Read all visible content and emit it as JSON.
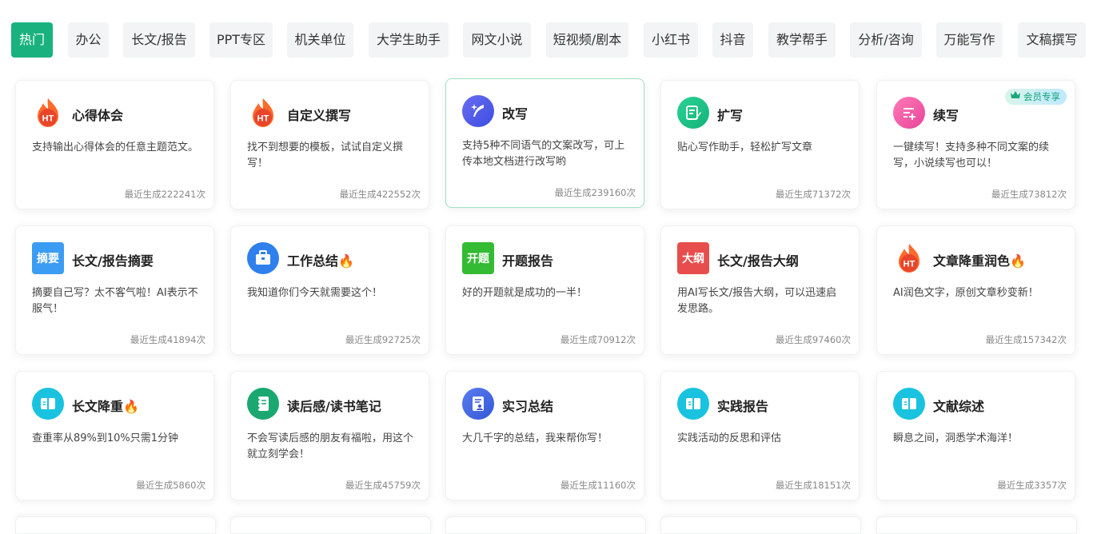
{
  "tabs": [
    {
      "label": "热门",
      "active": true
    },
    {
      "label": "办公"
    },
    {
      "label": "长文/报告"
    },
    {
      "label": "PPT专区"
    },
    {
      "label": "机关单位"
    },
    {
      "label": "大学生助手"
    },
    {
      "label": "网文小说"
    },
    {
      "label": "短视频/剧本"
    },
    {
      "label": "小红书"
    },
    {
      "label": "抖音"
    },
    {
      "label": "教学帮手"
    },
    {
      "label": "分析/咨询"
    },
    {
      "label": "万能写作"
    },
    {
      "label": "文稿撰写"
    }
  ],
  "cards": [
    {
      "title": "心得体会",
      "desc": "支持输出心得体会的任意主题范文。",
      "count": "最近生成222241次",
      "icon": "fire-ht-icon"
    },
    {
      "title": "自定义撰写",
      "desc": "找不到想要的模板，试试自定义撰写！",
      "count": "最近生成422552次",
      "icon": "fire-ht-icon"
    },
    {
      "title": "改写",
      "desc": "支持5种不同语气的文案改写，可上传本地文档进行改写哟",
      "count": "最近生成239160次",
      "icon": "feather-sparkle-icon"
    },
    {
      "title": "扩写",
      "desc": "贴心写作助手，轻松扩写文章",
      "count": "最近生成71372次",
      "icon": "edit-note-icon"
    },
    {
      "title": "续写",
      "desc": "一键续写！支持多种不同文案的续写，小说续写也可以！",
      "count": "最近生成73812次",
      "icon": "continue-write-icon",
      "badge": "会员专享"
    },
    {
      "title": "长文/报告摘要",
      "desc": "摘要自己写？太不客气啦！AI表示不服气！",
      "count": "最近生成41894次",
      "icon": "summary-square-icon",
      "icon_text": "摘要"
    },
    {
      "title": "工作总结🔥",
      "desc": "我知道你们今天就需要这个！",
      "count": "最近生成92725次",
      "icon": "briefcase-icon"
    },
    {
      "title": "开题报告",
      "desc": "好的开题就是成功的一半！",
      "count": "最近生成70912次",
      "icon": "proposal-square-icon",
      "icon_text": "开题"
    },
    {
      "title": "长文/报告大纲",
      "desc": "用AI写长文/报告大纲，可以迅速启发思路。",
      "count": "最近生成97460次",
      "icon": "outline-square-icon",
      "icon_text": "大纲"
    },
    {
      "title": "文章降重润色🔥",
      "desc": "AI润色文字，原创文章秒变新！",
      "count": "最近生成157342次",
      "icon": "fire-ht-icon"
    },
    {
      "title": "长文降重🔥",
      "desc": "查重率从89%到10%只需1分钟",
      "count": "最近生成5860次",
      "icon": "book-icon"
    },
    {
      "title": "读后感/读书笔记",
      "desc": "不会写读后感的朋友有福啦，用这个就立刻学会！",
      "count": "最近生成45759次",
      "icon": "notebook-icon"
    },
    {
      "title": "实习总结",
      "desc": "大几千字的总结，我来帮你写！",
      "count": "最近生成11160次",
      "icon": "report-user-icon"
    },
    {
      "title": "实践报告",
      "desc": "实践活动的反思和评估",
      "count": "最近生成18151次",
      "icon": "book-icon"
    },
    {
      "title": "文献综述",
      "desc": "瞬息之间，洞悉学术海洋！",
      "count": "最近生成3357次",
      "icon": "book-icon"
    }
  ]
}
